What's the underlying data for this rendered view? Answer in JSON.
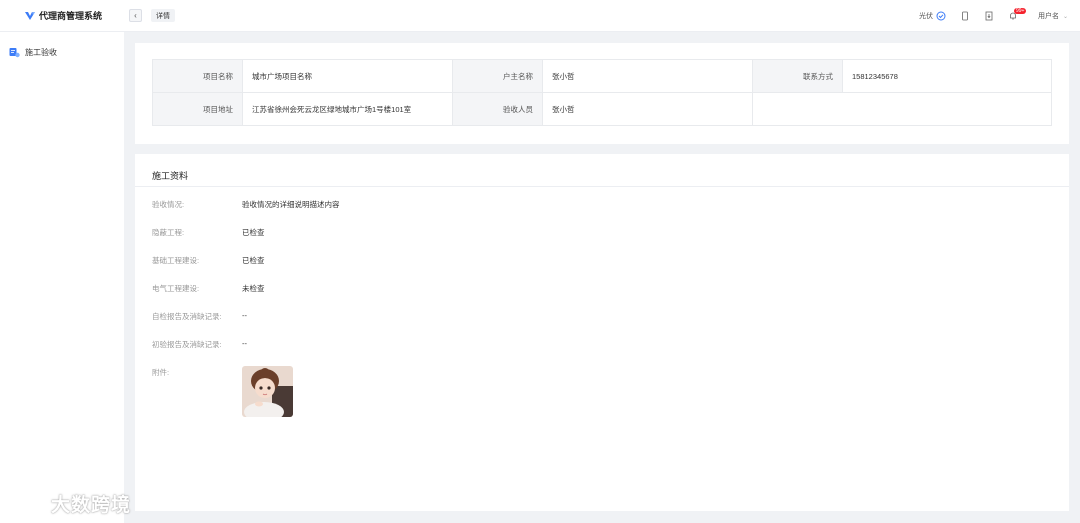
{
  "app": {
    "title": "代理商管理系统",
    "back_icon": "chevron-left-icon"
  },
  "tabs": [
    {
      "label": "详情"
    }
  ],
  "header": {
    "theme_label": "光伏",
    "notification_count": "99+",
    "user_name": "用户名"
  },
  "sidebar": {
    "items": [
      {
        "label": "施工验收",
        "icon": "acceptance-icon"
      }
    ]
  },
  "project_info": {
    "rows": [
      {
        "l1": "项目名称",
        "v1": "城市广场项目名称",
        "l2": "户主名称",
        "v2": "张小哲",
        "l3": "联系方式",
        "v3": "15812345678"
      },
      {
        "l1": "项目地址",
        "v1": "江苏省徐州会死云龙区绿地城市广场1号楼101室",
        "l2": "验收人员",
        "v2": "张小哲",
        "l3": "",
        "v3": ""
      }
    ]
  },
  "construction": {
    "title": "施工资料",
    "items": [
      {
        "label": "验收情况:",
        "value": "验收情况的详细说明描述内容"
      },
      {
        "label": "隐蔽工程:",
        "value": "已检查"
      },
      {
        "label": "基础工程建设:",
        "value": "已检查"
      },
      {
        "label": "电气工程建设:",
        "value": "未检查"
      },
      {
        "label": "自检报告及消缺记录:",
        "value": "--"
      },
      {
        "label": "初验报告及消缺记录:",
        "value": "--"
      },
      {
        "label": "附件:",
        "value": ""
      }
    ]
  },
  "watermark": {
    "text": "大数跨境"
  },
  "colors": {
    "accent": "#3d7cf7",
    "badge": "#f5222d",
    "background": "#f0f2f5"
  }
}
